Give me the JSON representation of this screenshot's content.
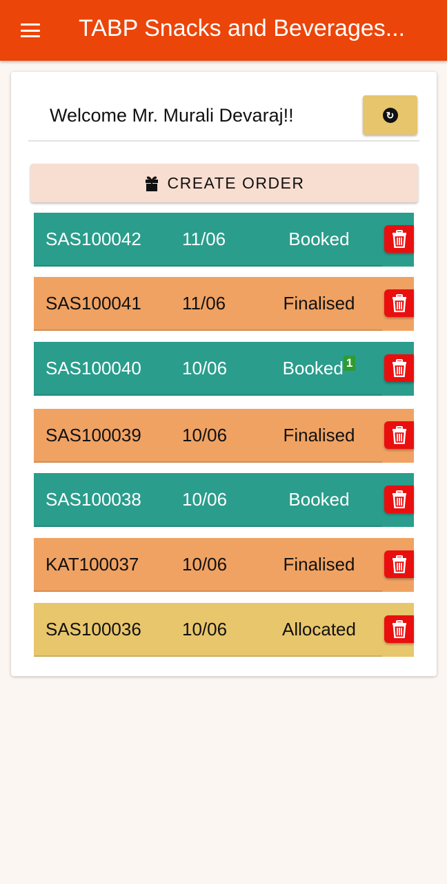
{
  "header": {
    "title": "TABP Snacks and Beverages..."
  },
  "welcome": "Welcome Mr. Murali Devaraj!!",
  "create_order_label": "CREATE ORDER",
  "colors": {
    "appbar": "#ec4509",
    "booked": "#2a9d8c",
    "finalised": "#f0a262",
    "allocated": "#e8c66c",
    "delete": "#ea0f0f",
    "badge": "#2e9b34"
  },
  "orders": [
    {
      "id": "SAS100042",
      "date": "11/06",
      "status": "Booked",
      "badge": ""
    },
    {
      "id": "SAS100041",
      "date": "11/06",
      "status": "Finalised",
      "badge": ""
    },
    {
      "id": "SAS100040",
      "date": "10/06",
      "status": "Booked",
      "badge": "1"
    },
    {
      "id": "SAS100039",
      "date": "10/06",
      "status": "Finalised",
      "badge": ""
    },
    {
      "id": "SAS100038",
      "date": "10/06",
      "status": "Booked",
      "badge": ""
    },
    {
      "id": "KAT100037",
      "date": "10/06",
      "status": "Finalised",
      "badge": ""
    },
    {
      "id": "SAS100036",
      "date": "10/06",
      "status": "Allocated",
      "badge": ""
    }
  ]
}
